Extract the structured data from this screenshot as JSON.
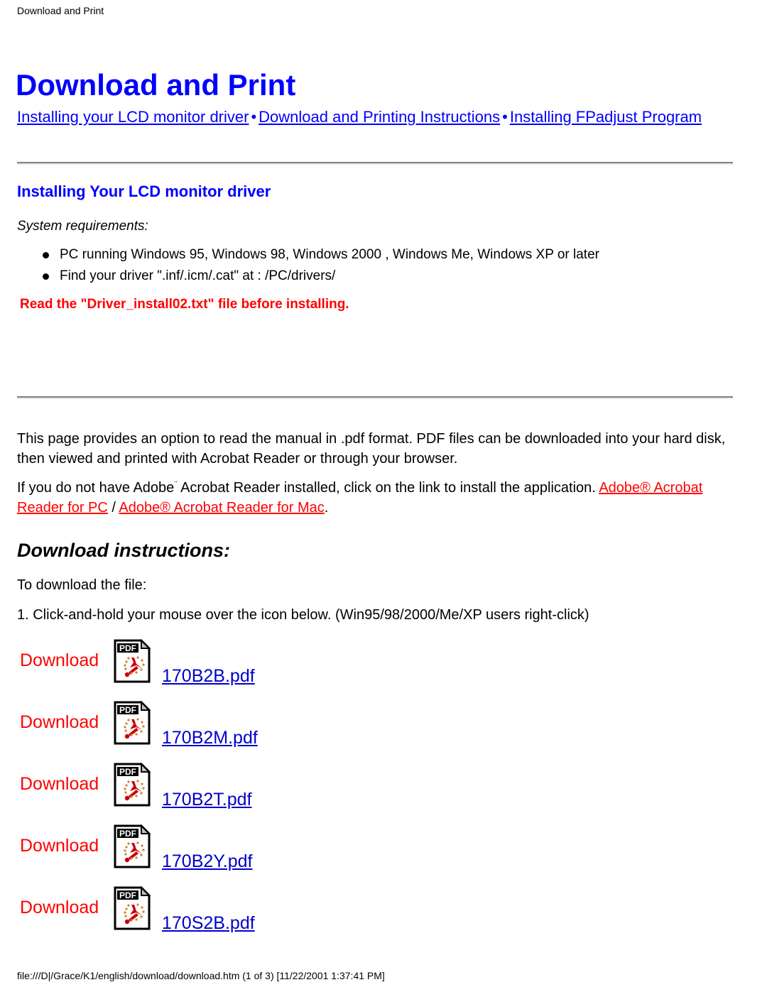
{
  "breadcrumb": "Download and Print",
  "page_title": "Download and Print",
  "nav": {
    "separator": "•",
    "links": [
      "Installing your LCD monitor driver",
      "Download and Printing Instructions",
      "Installing FPadjust Program"
    ]
  },
  "driver_section": {
    "heading": "Installing Your LCD monitor driver",
    "sysreq_label": "System requirements:",
    "bullets": [
      "PC running Windows 95, Windows 98, Windows 2000 , Windows Me, Windows XP or later",
      "Find your driver \".inf/.icm/.cat\" at : /PC/drivers/"
    ],
    "warning": "Read the \"Driver_install02.txt\" file before installing."
  },
  "paragraphs": {
    "p1": "This page provides an option to read the manual in .pdf format. PDF files can be downloaded into your hard disk, then viewed and printed with Acrobat Reader or through your browser.",
    "p2_before": "If you do not have Adobe",
    "p2_tm": "¨",
    "p2_mid": " Acrobat Reader installed, click on the link to install the application. ",
    "p2_link_pc": "Adobe® Acrobat Reader for PC",
    "p2_slash": " / ",
    "p2_link_mac": "Adobe® Acrobat Reader for Mac",
    "p2_end": "."
  },
  "download_section": {
    "heading": "Download instructions:",
    "line1": "To download the file:",
    "line2": "1. Click-and-hold your mouse over the icon below. (Win95/98/2000/Me/XP users right-click)",
    "rows": [
      {
        "label": "Download",
        "icon": "pdf-file-icon",
        "file": "170B2B.pdf"
      },
      {
        "label": "Download",
        "icon": "pdf-file-icon",
        "file": "170B2M.pdf"
      },
      {
        "label": "Download",
        "icon": "pdf-file-icon",
        "file": "170B2T.pdf"
      },
      {
        "label": "Download",
        "icon": "pdf-file-icon",
        "file": "170B2Y.pdf"
      },
      {
        "label": "Download",
        "icon": "pdf-file-icon",
        "file": "170S2B.pdf"
      }
    ]
  },
  "footer": "file:///D|/Grace/K1/english/download/download.htm (1 of 3) [11/22/2001 1:37:41 PM]",
  "colors": {
    "link_blue": "#0000ff",
    "title_blue": "#0000ff",
    "warning_red": "#ff0000",
    "download_red": "#ff0000",
    "file_link_blue": "#0000cc",
    "text_black": "#000000"
  }
}
